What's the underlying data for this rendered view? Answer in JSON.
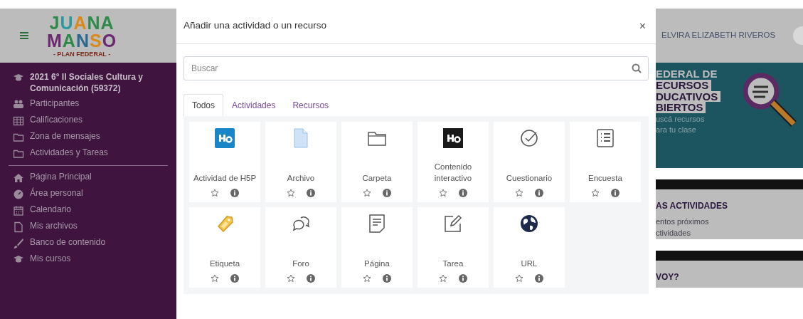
{
  "sidebar": {
    "logo": {
      "lines": [
        "JUANA",
        "MANSO"
      ],
      "tagline": "- PLAN FEDERAL -"
    },
    "sections": [
      {
        "items": [
          {
            "kind": "course",
            "label": "2021 6° II Sociales Cultura y Comunicación (59372)"
          },
          {
            "kind": "link",
            "label": "Participantes"
          },
          {
            "kind": "link",
            "label": "Calificaciones"
          },
          {
            "kind": "link",
            "label": "Zona de mensajes"
          },
          {
            "kind": "link",
            "label": "Actividades y Tareas"
          }
        ]
      },
      {
        "items": [
          {
            "kind": "link",
            "label": "Página Principal"
          },
          {
            "kind": "link",
            "label": "Área personal"
          },
          {
            "kind": "link",
            "label": "Calendario"
          },
          {
            "kind": "link",
            "label": "Mis archivos"
          },
          {
            "kind": "link",
            "label": "Banco de contenido"
          },
          {
            "kind": "link",
            "label": "Mis cursos"
          }
        ]
      }
    ]
  },
  "modal": {
    "title": "Añadir una actividad o un recurso",
    "close": "×",
    "search": {
      "placeholder": "Buscar"
    },
    "tabs": [
      {
        "label": "Todos",
        "selected": true
      },
      {
        "label": "Actividades",
        "selected": false
      },
      {
        "label": "Recursos",
        "selected": false
      }
    ],
    "modules": [
      {
        "name": "Actividad de H5P",
        "starred": false
      },
      {
        "name": "Archivo",
        "starred": false
      },
      {
        "name": "Carpeta",
        "starred": false
      },
      {
        "name": "Contenido interactivo",
        "starred": false
      },
      {
        "name": "Cuestionario",
        "starred": false
      },
      {
        "name": "Encuesta",
        "starred": false
      },
      {
        "name": "Etiqueta",
        "starred": false
      },
      {
        "name": "Foro",
        "starred": false
      },
      {
        "name": "Página",
        "starred": false
      },
      {
        "name": "Tarea",
        "starred": false
      },
      {
        "name": "URL",
        "starred": false
      }
    ]
  },
  "background": {
    "user_name": "ELVIRA ELIZABETH RIVEROS",
    "banner": {
      "title_lines": [
        "EDERAL DE",
        "ECURSOS",
        "DUCATIVOS",
        "BIERTOS"
      ],
      "subtitle_lines": [
        "uscá recursos",
        "ara tu clase"
      ]
    },
    "blocks": [
      {
        "title": "AS ACTIVIDADES",
        "lines": [
          "entos próximos",
          "ctividades"
        ]
      },
      {
        "title": "VOY?"
      }
    ]
  }
}
